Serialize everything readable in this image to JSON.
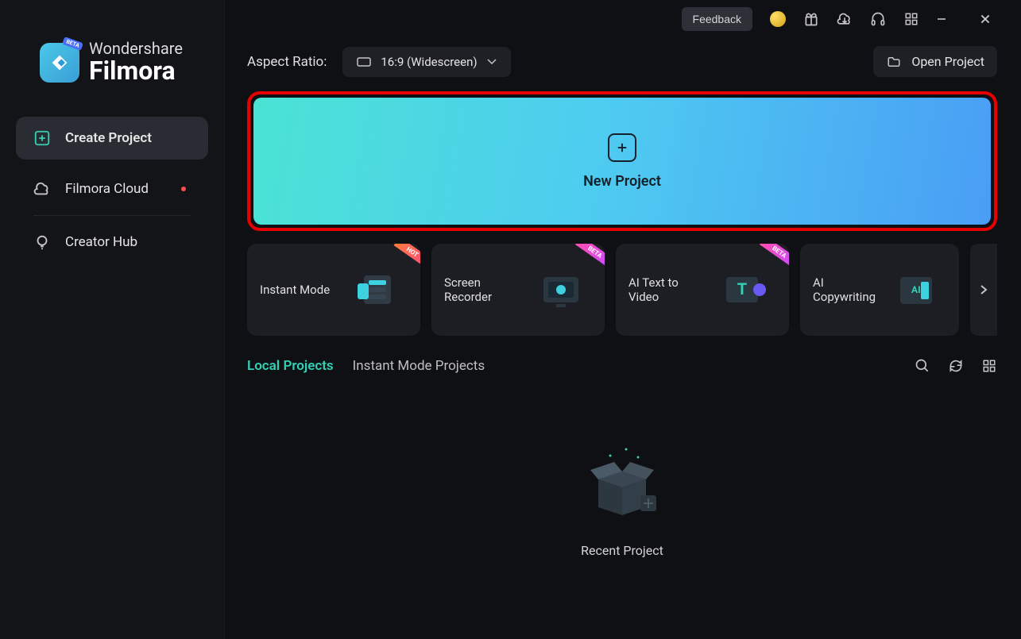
{
  "brand": {
    "name": "Wondershare",
    "product": "Filmora",
    "badge": "BETA"
  },
  "sidebar": {
    "items": [
      {
        "label": "Create Project",
        "icon": "plus-box"
      },
      {
        "label": "Filmora Cloud",
        "icon": "cloud",
        "dot": true
      },
      {
        "label": "Creator Hub",
        "icon": "bulb"
      }
    ]
  },
  "titlebar": {
    "feedback": "Feedback"
  },
  "aspect": {
    "label": "Aspect Ratio:",
    "selected": "16:9 (Widescreen)"
  },
  "open_project": "Open Project",
  "new_project": "New Project",
  "cards": [
    {
      "label": "Instant Mode",
      "badge": "HOT"
    },
    {
      "label": "Screen Recorder",
      "badge": "BETA"
    },
    {
      "label": "AI Text to Video",
      "badge": "BETA"
    },
    {
      "label": "AI Copywriting"
    }
  ],
  "tabs": {
    "local": "Local Projects",
    "instant": "Instant Mode Projects"
  },
  "empty_label": "Recent Project"
}
